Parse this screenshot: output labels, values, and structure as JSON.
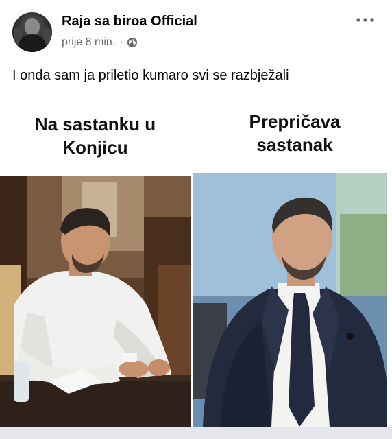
{
  "post": {
    "page_name": "Raja sa biroa Official",
    "timestamp": "prije 8 min.",
    "separator": "·",
    "privacy_icon": "globe-icon",
    "more_icon": "more-options-icon",
    "caption": "I onda sam ja priletio kumaro svi se razbježali"
  },
  "meme": {
    "left_panel": {
      "line1": "Na sastanku u",
      "line2": "Konjicu",
      "photo": "man-in-white-shirt-at-desk-photo"
    },
    "right_panel": {
      "line1": "Prepričava",
      "line2": "sastanak",
      "photo": "man-in-suit-tv-studio-photo"
    }
  }
}
